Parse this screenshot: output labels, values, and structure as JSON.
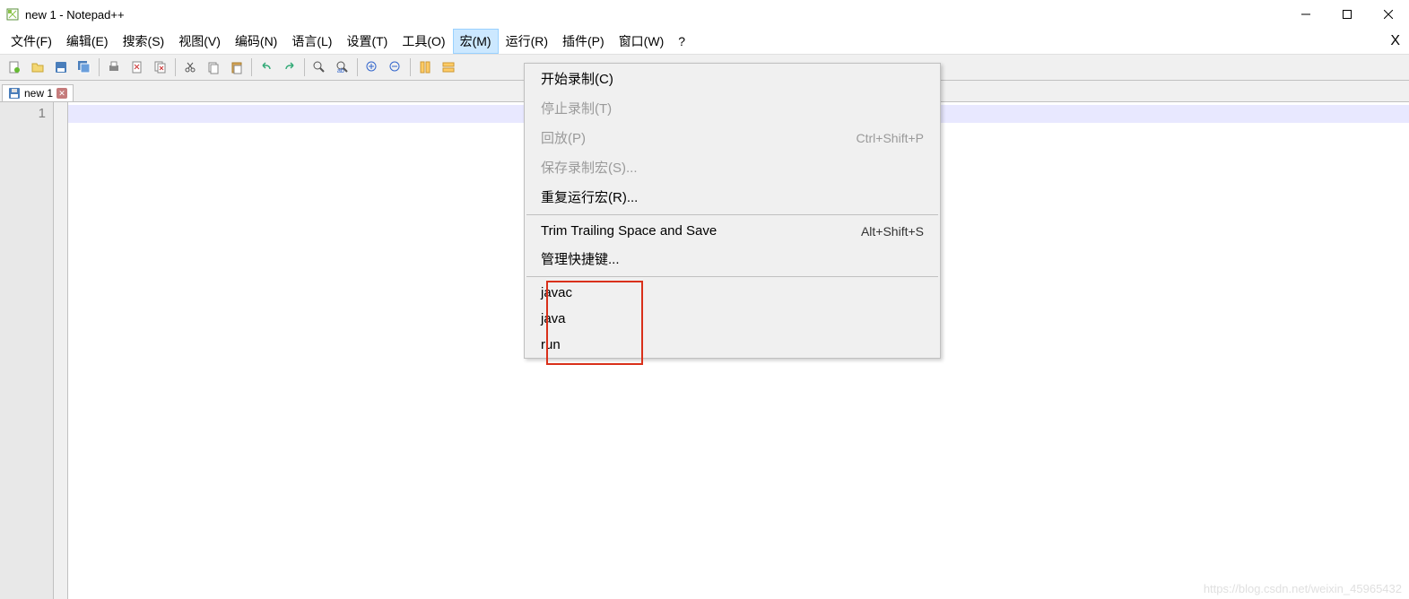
{
  "title": "new 1 - Notepad++",
  "menubar": {
    "items": [
      "文件(F)",
      "编辑(E)",
      "搜索(S)",
      "视图(V)",
      "编码(N)",
      "语言(L)",
      "设置(T)",
      "工具(O)",
      "宏(M)",
      "运行(R)",
      "插件(P)",
      "窗口(W)",
      "?"
    ],
    "active_index": 8
  },
  "tab": {
    "label": "new 1"
  },
  "editor": {
    "line_number": "1"
  },
  "dropdown": {
    "sections": [
      [
        {
          "label": "开始录制(C)",
          "shortcut": "",
          "disabled": false
        },
        {
          "label": "停止录制(T)",
          "shortcut": "",
          "disabled": true
        },
        {
          "label": "回放(P)",
          "shortcut": "Ctrl+Shift+P",
          "disabled": true
        },
        {
          "label": "保存录制宏(S)...",
          "shortcut": "",
          "disabled": true
        },
        {
          "label": "重复运行宏(R)...",
          "shortcut": "",
          "disabled": false
        }
      ],
      [
        {
          "label": "Trim Trailing Space and Save",
          "shortcut": "Alt+Shift+S",
          "disabled": false
        },
        {
          "label": "管理快捷键...",
          "shortcut": "",
          "disabled": false
        }
      ],
      [
        {
          "label": "javac",
          "shortcut": "",
          "disabled": false
        },
        {
          "label": "java",
          "shortcut": "",
          "disabled": false
        },
        {
          "label": "run",
          "shortcut": "",
          "disabled": false
        }
      ]
    ]
  },
  "watermark": "https://blog.csdn.net/weixin_45965432",
  "toolbar_icons": [
    "new-file-icon",
    "open-file-icon",
    "save-icon",
    "save-all-icon",
    "sep",
    "print-icon",
    "close-icon",
    "close-all-icon",
    "sep",
    "cut-icon",
    "copy-icon",
    "paste-icon",
    "sep",
    "undo-icon",
    "redo-icon",
    "sep",
    "find-icon",
    "replace-icon",
    "sep",
    "zoom-in-icon",
    "zoom-out-icon",
    "sep",
    "sync-v-icon",
    "sync-h-icon"
  ]
}
